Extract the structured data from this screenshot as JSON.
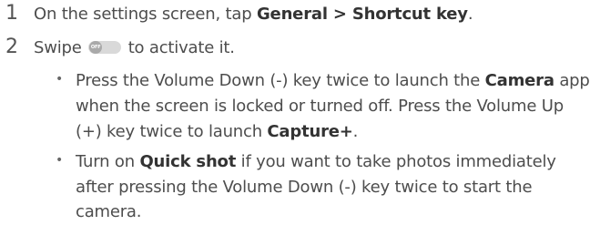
{
  "steps": [
    {
      "number": "1",
      "text_before": "On the settings screen, tap ",
      "bold1": "General",
      "sep": " > ",
      "bold2": "Shortcut key",
      "text_after": "."
    },
    {
      "number": "2",
      "text_before": "Swipe ",
      "toggle_label": "OFF",
      "text_after": " to activate it."
    }
  ],
  "bullets": [
    {
      "symbol": "•",
      "line1_a": "Press the Volume Down (-) key twice to launch the ",
      "line1_b": "Camera",
      "line1_c": " app",
      "line2": "when the screen is locked or turned off. Press the Volume Up",
      "line3_a": "(+) key twice to launch ",
      "line3_b": "Capture+",
      "line3_c": "."
    },
    {
      "symbol": "•",
      "line1_a": "Turn on ",
      "line1_b": "Quick shot",
      "line1_c": " if you want to take photos immediately",
      "line2": "after pressing the Volume Down (-) key twice to start the",
      "line3": "camera."
    }
  ]
}
